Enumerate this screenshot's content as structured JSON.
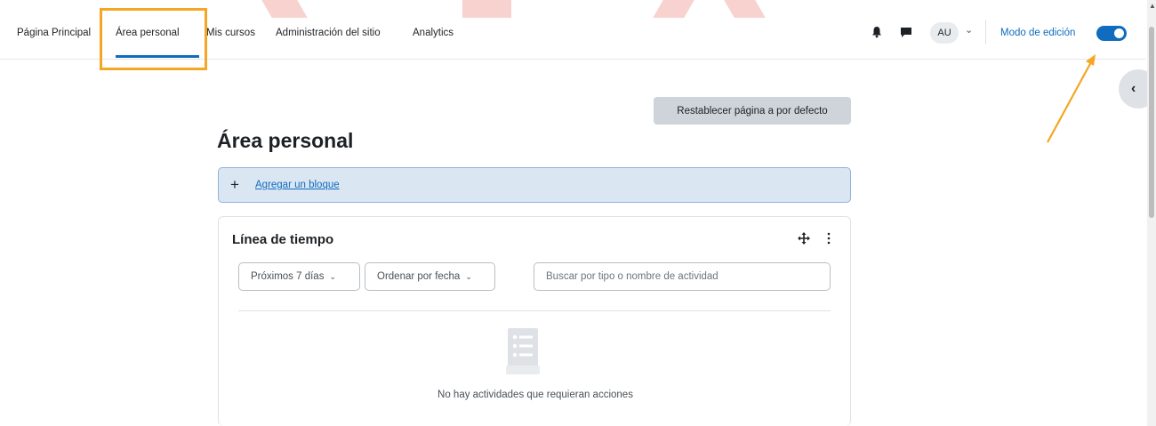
{
  "navbar": {
    "items": [
      {
        "label": "Página Principal"
      },
      {
        "label": "Área personal"
      },
      {
        "label": "Mis cursos"
      },
      {
        "label": "Administración del sitio"
      },
      {
        "label": "Analytics"
      }
    ],
    "active_index": 1,
    "avatar_initials": "AU",
    "edit_mode_label": "Modo de edición",
    "edit_mode_on": true,
    "icons": [
      "bell-icon",
      "chat-icon",
      "chevron-down-icon",
      "chevron-left-icon"
    ]
  },
  "main": {
    "reset_button_label": "Restablecer página a por defecto",
    "page_title": "Área personal",
    "add_block_label": "Agregar un bloque",
    "timeline": {
      "title": "Línea de tiempo",
      "filter_label": "Próximos 7 días",
      "sort_label": "Ordenar por fecha",
      "search_placeholder": "Buscar por tipo o nombre de actividad",
      "empty_message": "No hay actividades que requieran acciones"
    }
  },
  "colors": {
    "accent": "#0f6cbf",
    "annotation": "#f5a623",
    "add_block_bg": "#dbe6f3"
  }
}
